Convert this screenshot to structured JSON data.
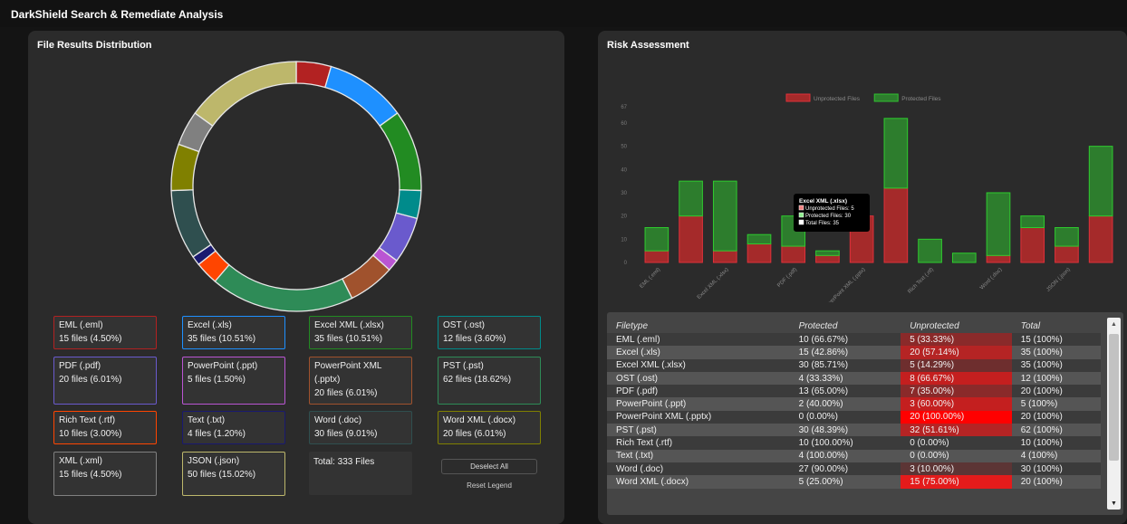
{
  "app": {
    "title": "DarkShield Search & Remediate Analysis"
  },
  "left_panel": {
    "title": "File Results Distribution",
    "legend": [
      {
        "name": "EML (.eml)",
        "detail": "15 files (4.50%)",
        "color": "#b22222"
      },
      {
        "name": "Excel (.xls)",
        "detail": "35 files (10.51%)",
        "color": "#1e90ff"
      },
      {
        "name": "Excel XML (.xlsx)",
        "detail": "35 files (10.51%)",
        "color": "#228b22"
      },
      {
        "name": "OST (.ost)",
        "detail": "12 files (3.60%)",
        "color": "#008b8b"
      },
      {
        "name": "PDF (.pdf)",
        "detail": "20 files (6.01%)",
        "color": "#6a5acd"
      },
      {
        "name": "PowerPoint (.ppt)",
        "detail": "5 files (1.50%)",
        "color": "#ba55d3"
      },
      {
        "name": "PowerPoint XML (.pptx)",
        "detail": "20 files (6.01%)",
        "color": "#a0522d"
      },
      {
        "name": "PST (.pst)",
        "detail": "62 files (18.62%)",
        "color": "#2e8b57"
      },
      {
        "name": "Rich Text (.rtf)",
        "detail": "10 files (3.00%)",
        "color": "#ff4500"
      },
      {
        "name": "Text (.txt)",
        "detail": "4 files (1.20%)",
        "color": "#191970"
      },
      {
        "name": "Word (.doc)",
        "detail": "30 files (9.01%)",
        "color": "#2f4f4f"
      },
      {
        "name": "Word XML (.docx)",
        "detail": "20 files (6.01%)",
        "color": "#808000"
      },
      {
        "name": "XML (.xml)",
        "detail": "15 files (4.50%)",
        "color": "#808080"
      },
      {
        "name": "JSON (.json)",
        "detail": "50 files (15.02%)",
        "color": "#bdb76b"
      }
    ],
    "total_label": "Total: 333 Files",
    "deselect_label": "Deselect All",
    "reset_label": "Reset Legend"
  },
  "right_panel": {
    "title": "Risk Assessment",
    "table": {
      "headers": [
        "Filetype",
        "Protected",
        "Unprotected",
        "Total"
      ],
      "rows": [
        [
          "EML (.eml)",
          "10 (66.67%)",
          "5 (33.33%)",
          "15 (100%)"
        ],
        [
          "Excel (.xls)",
          "15 (42.86%)",
          "20 (57.14%)",
          "35 (100%)"
        ],
        [
          "Excel XML (.xlsx)",
          "30 (85.71%)",
          "5 (14.29%)",
          "35 (100%)"
        ],
        [
          "OST (.ost)",
          "4 (33.33%)",
          "8 (66.67%)",
          "12 (100%)"
        ],
        [
          "PDF (.pdf)",
          "13 (65.00%)",
          "7 (35.00%)",
          "20 (100%)"
        ],
        [
          "PowerPoint (.ppt)",
          "2 (40.00%)",
          "3 (60.00%)",
          "5 (100%)"
        ],
        [
          "PowerPoint XML (.pptx)",
          "0 (0.00%)",
          "20 (100.00%)",
          "20 (100%)"
        ],
        [
          "PST (.pst)",
          "30 (48.39%)",
          "32 (51.61%)",
          "62 (100%)"
        ],
        [
          "Rich Text (.rtf)",
          "10 (100.00%)",
          "0 (0.00%)",
          "10 (100%)"
        ],
        [
          "Text (.txt)",
          "4 (100.00%)",
          "0 (0.00%)",
          "4 (100%)"
        ],
        [
          "Word (.doc)",
          "27 (90.00%)",
          "3 (10.00%)",
          "30 (100%)"
        ],
        [
          "Word XML (.docx)",
          "5 (25.00%)",
          "15 (75.00%)",
          "20 (100%)"
        ]
      ]
    },
    "tooltip": {
      "title": "Excel XML (.xlsx)",
      "lines": [
        "Unprotected Files: 5",
        "Protected Files: 30",
        "Total Files: 35"
      ]
    }
  },
  "chart_data": [
    {
      "type": "pie",
      "title": "File Results Distribution",
      "categories": [
        "EML (.eml)",
        "Excel (.xls)",
        "Excel XML (.xlsx)",
        "OST (.ost)",
        "PDF (.pdf)",
        "PowerPoint (.ppt)",
        "PowerPoint XML (.pptx)",
        "PST (.pst)",
        "Rich Text (.rtf)",
        "Text (.txt)",
        "Word (.doc)",
        "Word XML (.docx)",
        "XML (.xml)",
        "JSON (.json)"
      ],
      "values": [
        15,
        35,
        35,
        12,
        20,
        5,
        20,
        62,
        10,
        4,
        30,
        20,
        15,
        50
      ],
      "colors": [
        "#b22222",
        "#1e90ff",
        "#228b22",
        "#008b8b",
        "#6a5acd",
        "#ba55d3",
        "#a0522d",
        "#2e8b57",
        "#ff4500",
        "#191970",
        "#2f4f4f",
        "#808000",
        "#808080",
        "#bdb76b"
      ]
    },
    {
      "type": "bar",
      "title": "Risk Assessment",
      "stacked": true,
      "categories": [
        "EML (.eml)",
        "Excel (.xls)",
        "Excel XML (.xlsx)",
        "OST (.ost)",
        "PDF (.pdf)",
        "PowerPoint (.ppt)",
        "PowerPoint XML (.pptx)",
        "PST (.pst)",
        "Rich Text (.rtf)",
        "Text (.txt)",
        "Word (.doc)",
        "Word XML (.docx)",
        "XML (.xml)",
        "JSON (.json)"
      ],
      "x_tick_labels": [
        "EML (.eml)",
        "",
        "Excel XML (.xlsx)",
        "",
        "PDF (.pdf)",
        "",
        "PowerPoint XML (.pptx)",
        "",
        "Rich Text (.rtf)",
        "",
        "Word (.doc)",
        "",
        "JSON (.json)",
        ""
      ],
      "series": [
        {
          "name": "Unprotected Files",
          "values": [
            5,
            20,
            5,
            8,
            7,
            3,
            20,
            32,
            0,
            0,
            3,
            15,
            7,
            20
          ],
          "color": "#a52a2a"
        },
        {
          "name": "Protected Files",
          "values": [
            10,
            15,
            30,
            4,
            13,
            2,
            0,
            30,
            10,
            4,
            27,
            5,
            8,
            30
          ],
          "color": "#2d7d2d"
        }
      ],
      "ylim": [
        0,
        67
      ],
      "yticks": [
        0,
        10,
        20,
        30,
        40,
        50,
        60,
        67
      ],
      "legend": "top-center",
      "grid": false
    }
  ]
}
